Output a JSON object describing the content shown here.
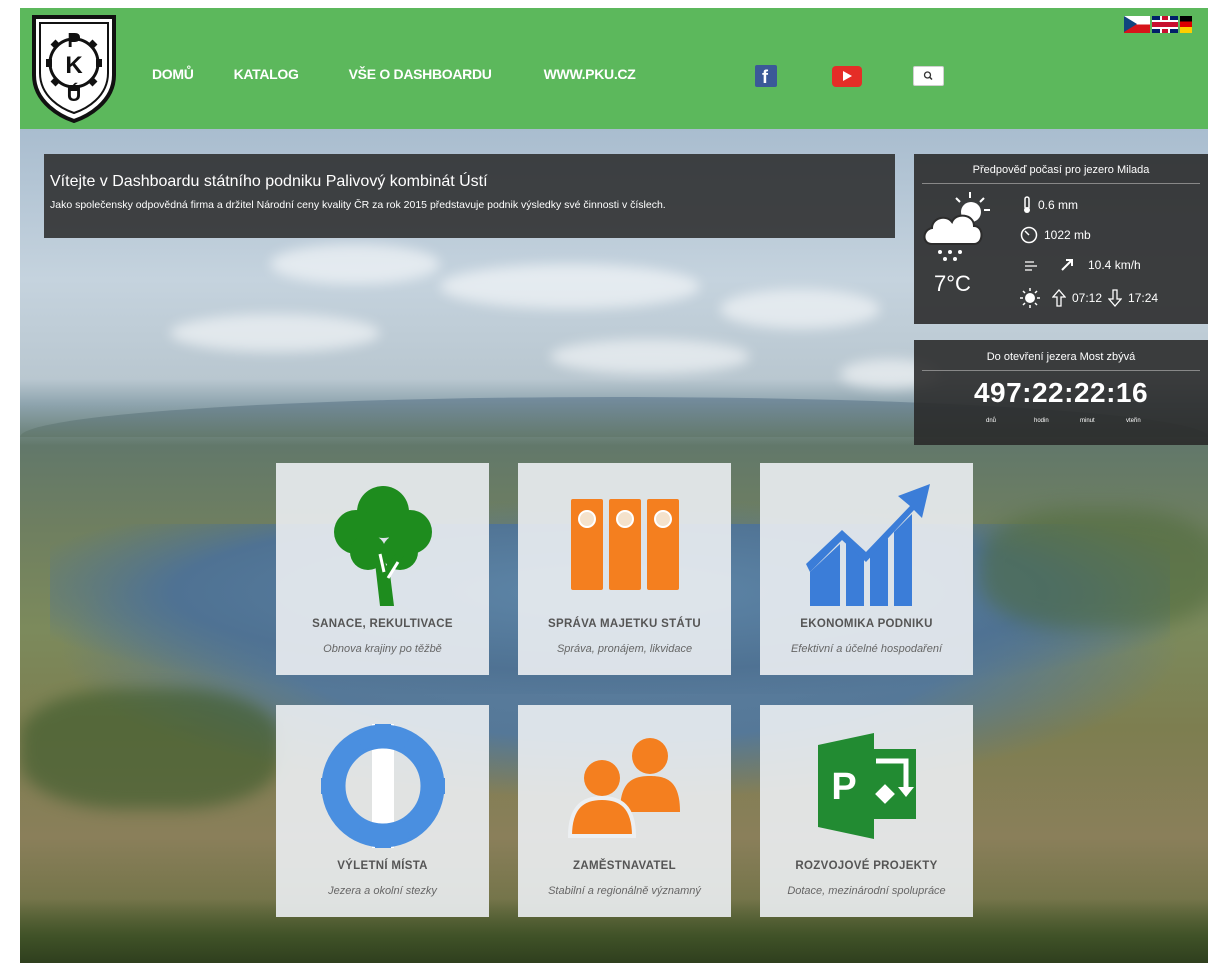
{
  "header": {
    "logo_letters": [
      "P",
      "K",
      "Ú"
    ],
    "nav": [
      "DOMŮ",
      "KATALOG",
      "VŠE O DASHBOARDU",
      "WWW.PKU.CZ"
    ],
    "social": {
      "facebook_icon": "facebook-icon",
      "youtube_icon": "youtube-icon",
      "search_icon": "search-icon"
    },
    "languages": [
      "cz-flag",
      "uk-flag",
      "de-flag"
    ],
    "bg_color": "#5cb85c"
  },
  "welcome": {
    "title": "Vítejte v Dashboardu státního podniku Palivový kombinát Ústí",
    "subtitle": "Jako společensky odpovědná firma a držitel Národní ceny kvality ČR za rok 2015 představuje podnik výsledky své činnosti v číslech."
  },
  "weather": {
    "title": "Předpověď počasí pro jezero Milada",
    "temperature": "7°C",
    "precipitation": "0.6 mm",
    "pressure": "1022 mb",
    "wind": "10.4 km/h",
    "sunrise": "07:12",
    "sunset": "17:24"
  },
  "countdown": {
    "title": "Do otevření jezera Most zbývá",
    "value": "497:22:22:16",
    "units": [
      "dnů",
      "hodin",
      "minut",
      "vteřin"
    ]
  },
  "tiles": [
    {
      "title": "SANACE, REKULTIVACE",
      "subtitle": "Obnova krajiny po těžbě",
      "icon": "tree-icon",
      "color": "#1e8c1e"
    },
    {
      "title": "SPRÁVA MAJETKU STÁTU",
      "subtitle": "Správa, pronájem, likvidace",
      "icon": "binders-icon",
      "color": "#f47f1f"
    },
    {
      "title": "EKONOMIKA PODNIKU",
      "subtitle": "Efektivní a účelné hospodaření",
      "icon": "growth-chart-icon",
      "color": "#3b7dd8"
    },
    {
      "title": "VÝLETNÍ MÍSTA",
      "subtitle": "Jezera a okolní stezky",
      "icon": "lifebuoy-icon",
      "color": "#4a8fe0"
    },
    {
      "title": "ZAMĚSTNAVATEL",
      "subtitle": "Stabilní a regionálně významný",
      "icon": "people-icon",
      "color": "#f47f1f"
    },
    {
      "title": "ROZVOJOVÉ PROJEKTY",
      "subtitle": "Dotace, mezinárodní spolupráce",
      "icon": "project-icon",
      "color": "#228b32"
    }
  ]
}
